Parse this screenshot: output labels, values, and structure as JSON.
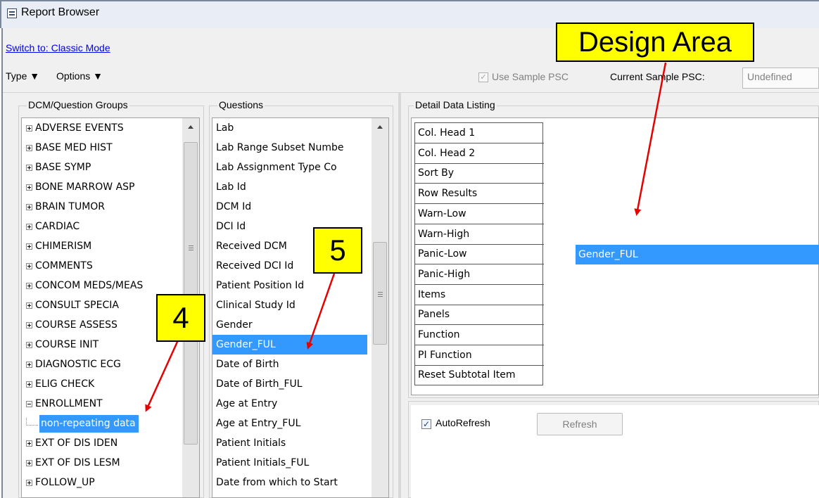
{
  "window": {
    "title": "Report Browser"
  },
  "toolbar": {
    "switch_link": "Switch to: Classic Mode",
    "type_menu": "Type ▼",
    "options_menu": "Options ▼",
    "use_sample_psc_label": "Use Sample PSC",
    "use_sample_psc_checked": true,
    "current_sample_psc_label": "Current Sample PSC:",
    "current_sample_psc_value": "Undefined"
  },
  "groups_panel": {
    "legend": "DCM/Question Groups",
    "items": [
      {
        "label": "ADVERSE EVENTS",
        "expanded": false
      },
      {
        "label": "BASE MED HIST",
        "expanded": false
      },
      {
        "label": "BASE SYMP",
        "expanded": false
      },
      {
        "label": "BONE MARROW ASP",
        "expanded": false
      },
      {
        "label": "BRAIN TUMOR",
        "expanded": false
      },
      {
        "label": "CARDIAC",
        "expanded": false
      },
      {
        "label": "CHIMERISM",
        "expanded": false
      },
      {
        "label": "COMMENTS",
        "expanded": false
      },
      {
        "label": "CONCOM MEDS/MEAS",
        "expanded": false
      },
      {
        "label": "CONSULT SPECIA",
        "expanded": false
      },
      {
        "label": "COURSE ASSESS",
        "expanded": false
      },
      {
        "label": "COURSE INIT",
        "expanded": false
      },
      {
        "label": "DIAGNOSTIC ECG",
        "expanded": false
      },
      {
        "label": "ELIG CHECK",
        "expanded": false
      },
      {
        "label": "ENROLLMENT",
        "expanded": true
      },
      {
        "label": "non-repeating data",
        "child": true,
        "selected": true
      },
      {
        "label": "EXT OF DIS IDEN",
        "expanded": false
      },
      {
        "label": "EXT OF DIS LESM",
        "expanded": false
      },
      {
        "label": "FOLLOW_UP",
        "expanded": false
      }
    ]
  },
  "questions_panel": {
    "legend": "Questions",
    "items": [
      "Lab",
      "Lab Range Subset Numbe",
      "Lab Assignment Type Co",
      "Lab Id",
      "DCM Id",
      "DCI Id",
      "Received DCM",
      "Received DCI Id",
      "Patient Position Id",
      "Clinical Study Id",
      "Gender",
      "Gender_FUL",
      "Date of Birth",
      "Date of Birth_FUL",
      "Age at Entry",
      "Age at Entry_FUL",
      "Patient Initials",
      "Patient Initials_FUL",
      "Date from which to Start"
    ],
    "selected_index": 11
  },
  "detail_panel": {
    "legend": "Detail Data Listing",
    "rows": [
      "Col. Head 1",
      "Col. Head 2",
      "Sort By",
      "Row Results",
      "Warn-Low",
      "Warn-High",
      "Panic-Low",
      "Panic-High",
      "Items",
      "Panels",
      "Function",
      "PI Function",
      "Reset Subtotal Item"
    ],
    "selected_cell": "Gender_FUL"
  },
  "bottom_panel": {
    "autorefresh_label": "AutoRefresh",
    "autorefresh_checked": true,
    "refresh_button": "Refresh"
  },
  "callouts": {
    "design_area": "Design Area",
    "step4": "4",
    "step5": "5"
  },
  "colors": {
    "selection": "#3399ff",
    "callout_fill": "#ffff00",
    "arrow": "#e60000",
    "link": "#0000ee"
  }
}
